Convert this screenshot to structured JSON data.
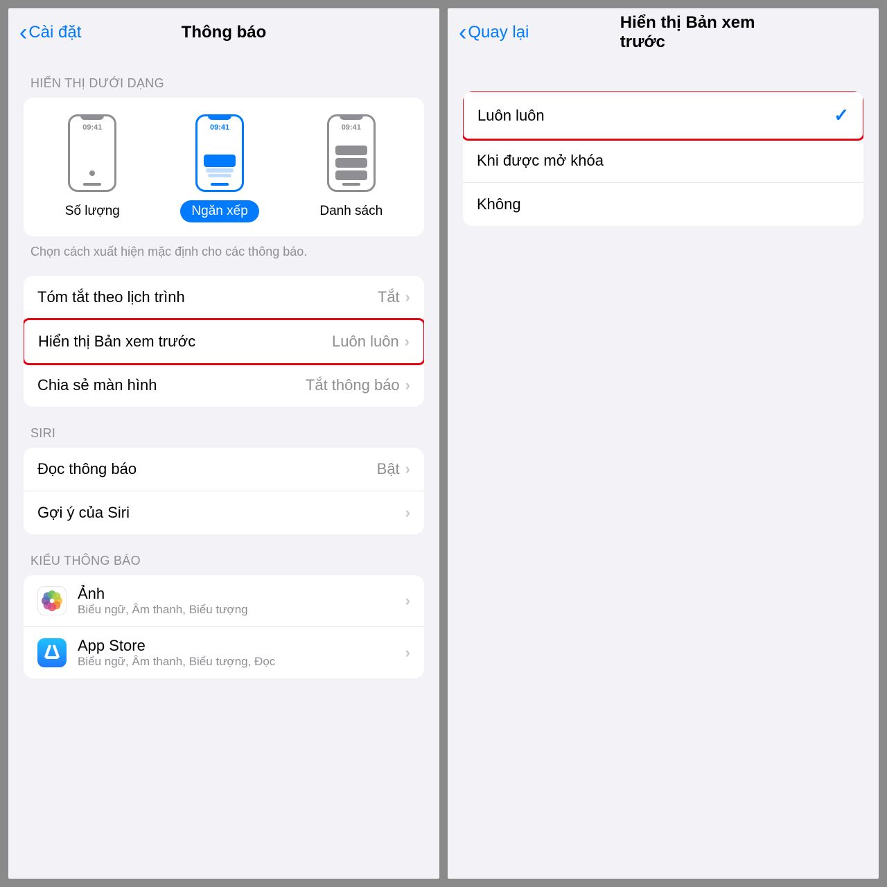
{
  "left": {
    "nav": {
      "back": "Cài đặt",
      "title": "Thông báo"
    },
    "display_section": {
      "header": "HIỂN THỊ DƯỚI DẠNG",
      "time": "09:41",
      "options": [
        "Số lượng",
        "Ngăn xếp",
        "Danh sách"
      ],
      "footer": "Chọn cách xuất hiện mặc định cho các thông báo."
    },
    "settings": [
      {
        "label": "Tóm tắt theo lịch trình",
        "value": "Tắt"
      },
      {
        "label": "Hiển thị Bản xem trước",
        "value": "Luôn luôn"
      },
      {
        "label": "Chia sẻ màn hình",
        "value": "Tắt thông báo"
      }
    ],
    "siri": {
      "header": "SIRI",
      "items": [
        {
          "label": "Đọc thông báo",
          "value": "Bật"
        },
        {
          "label": "Gợi ý của Siri",
          "value": ""
        }
      ]
    },
    "apps": {
      "header": "KIỂU THÔNG BÁO",
      "items": [
        {
          "name": "Ảnh",
          "sub": "Biểu ngữ, Âm thanh, Biểu tượng"
        },
        {
          "name": "App Store",
          "sub": "Biểu ngữ, Âm thanh, Biểu tượng, Đọc"
        }
      ]
    }
  },
  "right": {
    "nav": {
      "back": "Quay lại",
      "title": "Hiển thị Bản xem trước"
    },
    "options": [
      "Luôn luôn",
      "Khi được mở khóa",
      "Không"
    ]
  }
}
